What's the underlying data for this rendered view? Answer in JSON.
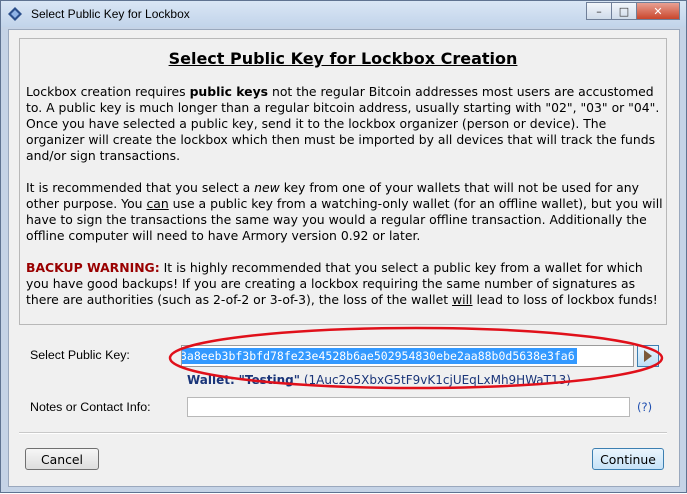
{
  "window": {
    "title": "Select Public Key for Lockbox",
    "controls": {
      "minimize": "–",
      "maximize": "□",
      "close": "✕"
    }
  },
  "info": {
    "heading": "Select Public Key for Lockbox Creation",
    "p1": {
      "a": "Lockbox creation requires ",
      "b": "public keys",
      "c": " not the regular Bitcoin addresses most users are accustomed to. A public key is much longer than a regular bitcoin address, usually starting with \"02\", \"03\" or \"04\". Once you have selected a public key, send it to the lockbox organizer (person or device). The organizer will create the lockbox which then must be imported by all devices that will track the funds and/or sign transactions."
    },
    "p2": {
      "a": "It is recommended that you select a ",
      "b": "new",
      "c": " key from one of your wallets that will not be used for any other purpose. You ",
      "d": "can",
      "e": " use a public key from a watching-only wallet (for an offline wallet), but you will have to sign the transactions the same way you would a regular offline transaction. Additionally the offline computer will need to have Armory version 0.92 or later."
    },
    "p3": {
      "warning": "BACKUP WARNING:",
      "a": " It is highly recommended that you select a public key from a wallet for which you have good backups! If you are creating a lockbox requiring the same number of signatures as there are authorities (such as 2-of-2 or 3-of-3), the loss of the wallet ",
      "b": "will",
      "c": " lead to loss of lockbox funds!"
    }
  },
  "form": {
    "public_key_label": "Select Public Key:",
    "public_key_value": "3a8eeb3bf3bfd78fe23e4528b6ae502954830ebe2aa88b0d5638e3fa6",
    "wallet_label": "Wallet:",
    "wallet_name": "\"Testing\"",
    "wallet_id": "(1Auc2o5XbxG5tF9vK1cjUEqLxMh9HWaT13)",
    "notes_label": "Notes or Contact Info:",
    "notes_value": "",
    "help": "(?)"
  },
  "buttons": {
    "cancel": "Cancel",
    "continue": "Continue"
  },
  "colors": {
    "highlight_ring": "#e0101a",
    "selection": "#3399ff",
    "warning": "#990000"
  }
}
